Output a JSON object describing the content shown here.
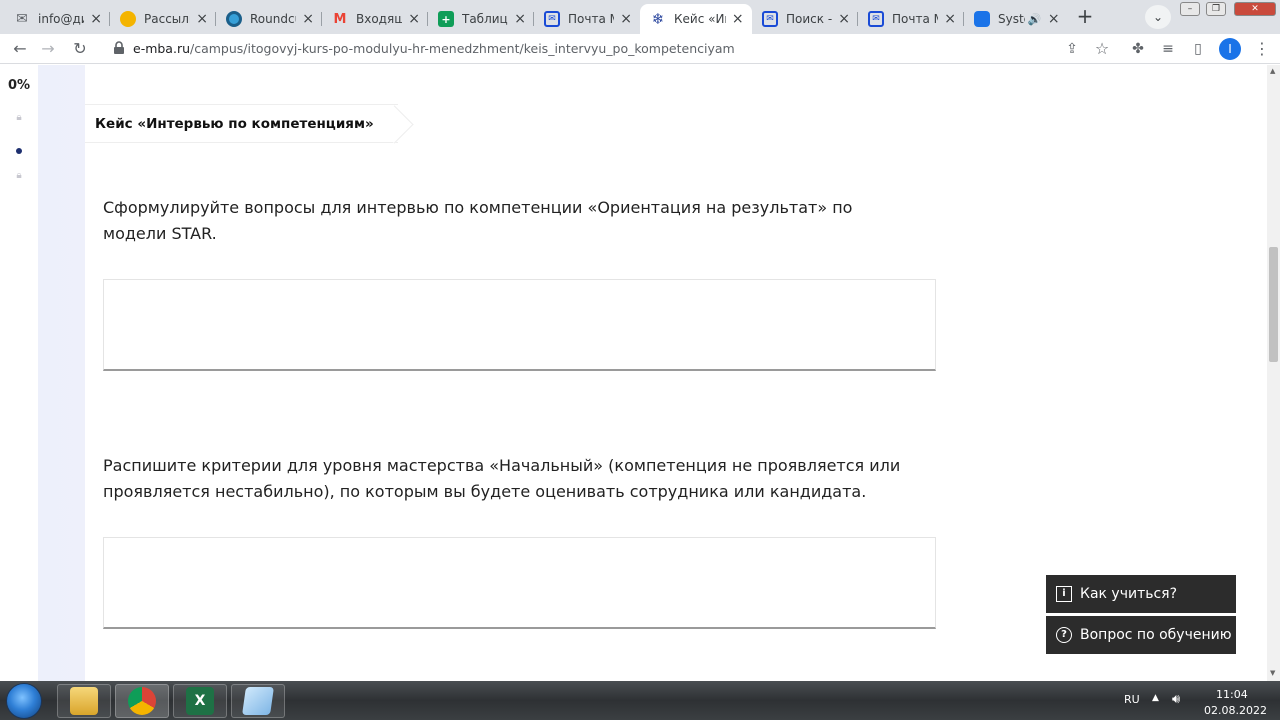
{
  "browser": {
    "tabs": [
      {
        "label": "info@ди",
        "icon": "envelope-x-icon",
        "color": "#5f6368"
      },
      {
        "label": "Рассылк",
        "icon": "mail-service-icon",
        "color": "#f4b400"
      },
      {
        "label": "Roundcu",
        "icon": "roundcube-icon",
        "color": "#37a0d8"
      },
      {
        "label": "Входящи",
        "icon": "gmail-icon",
        "color": "#ea4335"
      },
      {
        "label": "Таблица",
        "icon": "sheets-icon",
        "color": "#0f9d58"
      },
      {
        "label": "Почта М",
        "icon": "mail-icon",
        "color": "#1a4bd6"
      },
      {
        "label": "Кейс «Ин",
        "icon": "emba-snowflake-icon",
        "color": "#2f4aa0",
        "active": true
      },
      {
        "label": "Поиск - ",
        "icon": "mail-icon",
        "color": "#1a4bd6"
      },
      {
        "label": "Почта М",
        "icon": "mail-icon",
        "color": "#1a4bd6"
      },
      {
        "label": "Syste",
        "icon": "system-icon",
        "color": "#1a73e8",
        "audio": true
      }
    ],
    "new_tab_label": "+",
    "url_host": "e-mba.ru",
    "url_path": "/campus/itogovyj-kurs-po-modulyu-hr-menedzhment/keis_intervyu_po_kompetenciyam",
    "profile_initial": "I"
  },
  "sidebar": {
    "progress": "0%"
  },
  "lesson": {
    "tag": "Кейс «Интервью по компетенциям»",
    "questions": [
      {
        "text": "Сформулируйте вопросы для интервью по компетенции «Ориентация на результат» по модели STAR."
      },
      {
        "text": "Распишите критерии для уровня мастерства «Начальный» (компетенция не проявляется или проявляется нестабильно), по которым вы будете оценивать сотрудника или кандидата."
      }
    ]
  },
  "help": {
    "how_to_learn": "Как учиться?",
    "study_question": "Вопрос по обучению"
  },
  "taskbar": {
    "lang": "RU",
    "time": "11:04",
    "date": "02.08.2022",
    "apps": [
      "explorer-icon",
      "chrome-icon",
      "excel-icon",
      "notepad-icon"
    ]
  }
}
